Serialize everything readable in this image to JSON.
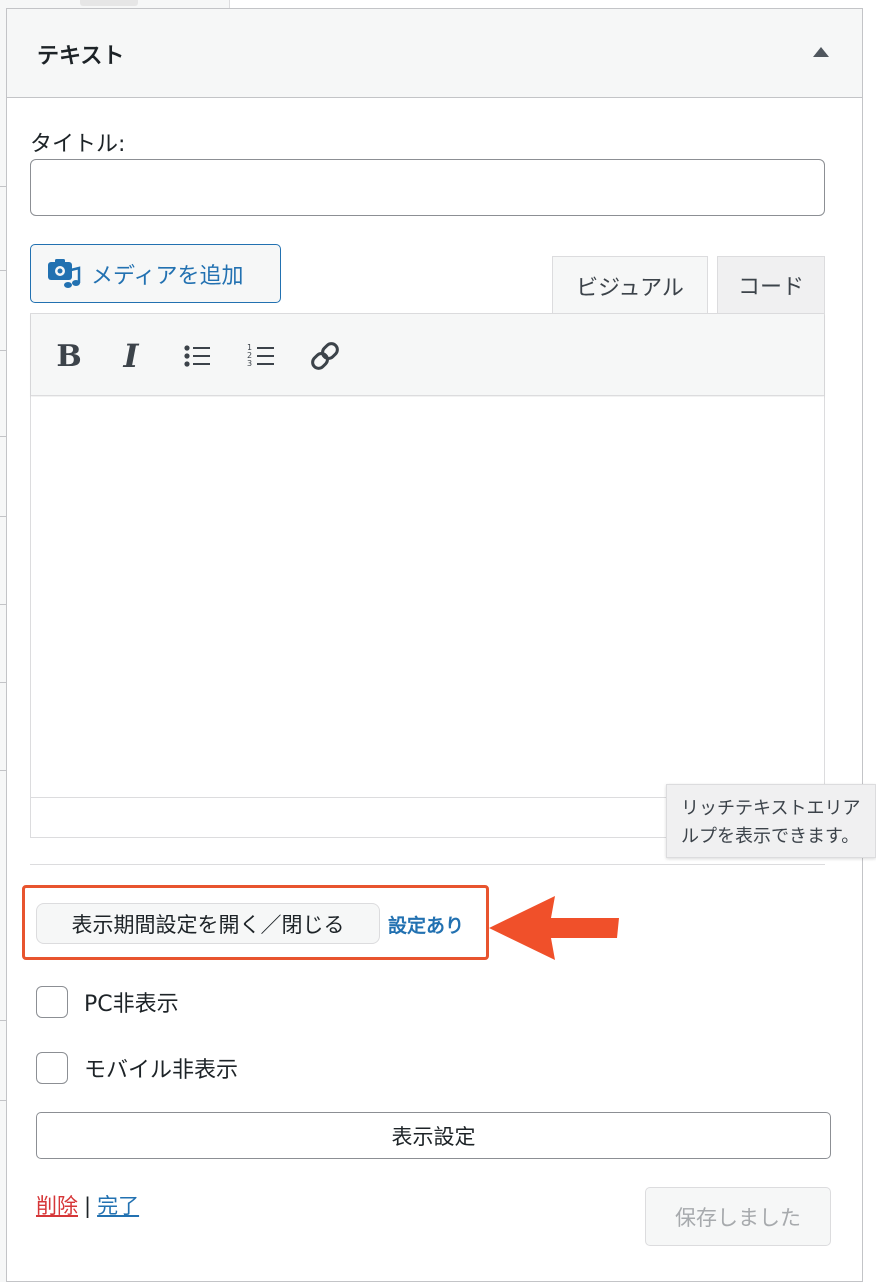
{
  "widget": {
    "title": "テキスト",
    "collapse_icon": "triangle-up-icon"
  },
  "title_field": {
    "label": "タイトル:",
    "value": "",
    "placeholder": ""
  },
  "media": {
    "add_media_label": "メディアを追加",
    "icon": "camera-music-icon"
  },
  "editor_tabs": [
    {
      "label": "ビジュアル",
      "active": true
    },
    {
      "label": "コード",
      "active": false
    }
  ],
  "toolbar": {
    "bold_label": "B",
    "italic_label": "I",
    "bullet_list_icon": "bullet-list-icon",
    "numbered_list_icon": "numbered-list-icon",
    "link_icon": "link-icon"
  },
  "tooltip": {
    "line1": "リッチテキストエリア",
    "line2": "ルプを表示できます。"
  },
  "display_period": {
    "toggle_label": "表示期間設定を開く／閉じる",
    "status": "設定あり"
  },
  "visibility": {
    "pc_hide_label": "PC非表示",
    "pc_hide_checked": false,
    "mobile_hide_label": "モバイル非表示",
    "mobile_hide_checked": false
  },
  "display_settings_label": "表示設定",
  "footer": {
    "delete_label": "削除",
    "separator": "|",
    "done_label": "完了",
    "saved_label": "保存しました"
  },
  "colors": {
    "accent": "#2271b1",
    "danger": "#d63638",
    "highlight": "#e8542e"
  }
}
